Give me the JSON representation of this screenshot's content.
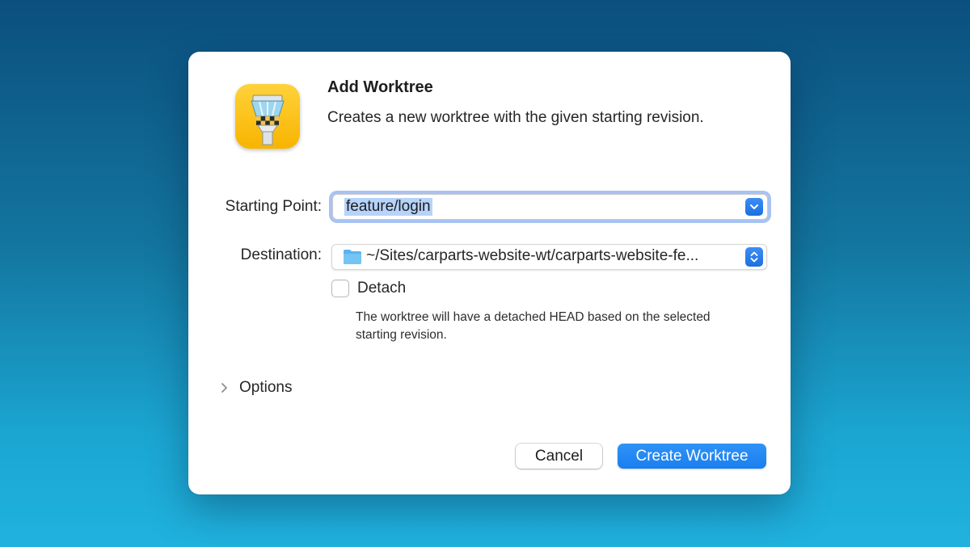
{
  "dialog": {
    "title": "Add Worktree",
    "subtitle": "Creates a new worktree with the given starting revision.",
    "app_icon": "tower-app-icon"
  },
  "form": {
    "starting_point": {
      "label": "Starting Point:",
      "value": "feature/login",
      "icon": "chevron-down-icon"
    },
    "destination": {
      "label": "Destination:",
      "value": "~/Sites/carparts-website-wt/carparts-website-fe...",
      "icon": "folder-icon",
      "stepper_icon": "up-down-chevron-icon"
    },
    "detach": {
      "label": "Detach",
      "checked": false,
      "help": "The worktree will have a detached HEAD based on the selected starting revision."
    },
    "options": {
      "label": "Options",
      "expanded": false
    }
  },
  "buttons": {
    "cancel": "Cancel",
    "create": "Create Worktree"
  },
  "colors": {
    "accent": "#1a7ef0",
    "selection": "#b6d3fa",
    "background_top": "#0b4f7e",
    "background_bottom": "#20b2de"
  }
}
